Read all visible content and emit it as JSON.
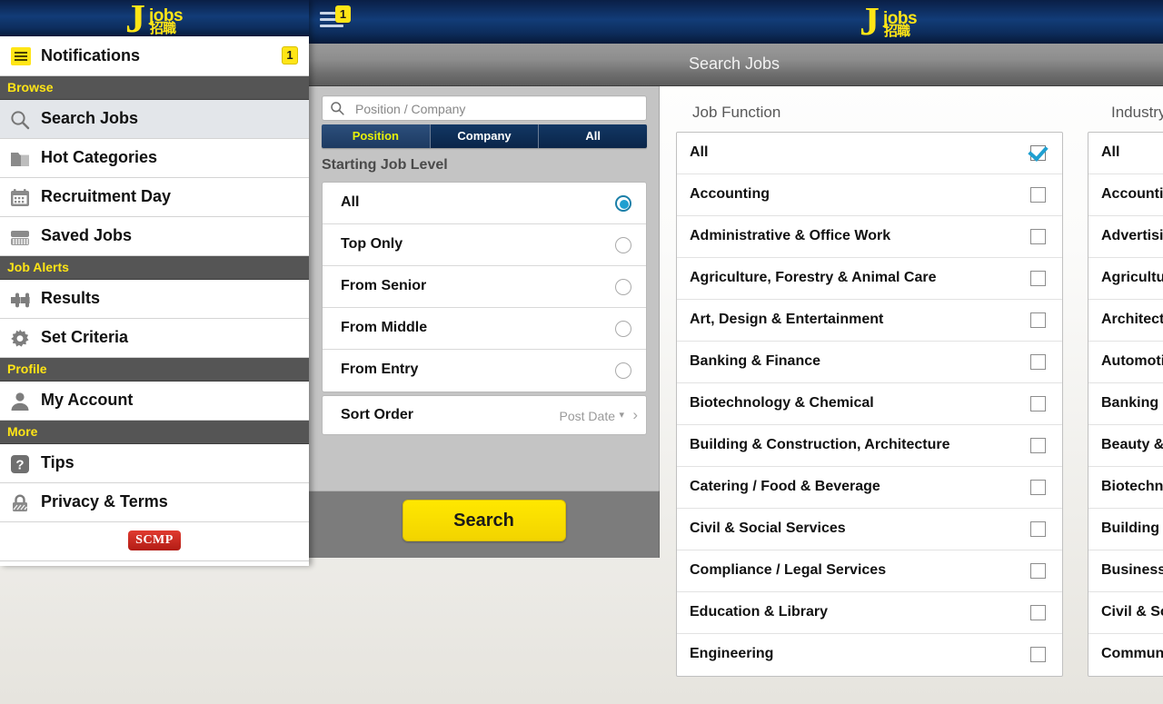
{
  "topbar": {
    "menu_badge": "1",
    "logo": {
      "letter": "J",
      "word": "jobs",
      "cn": "招職"
    }
  },
  "titlebar": {
    "title": "Search Jobs"
  },
  "drawer": {
    "logo": {
      "letter": "J",
      "word": "jobs",
      "cn": "招職"
    },
    "notifications": {
      "label": "Notifications",
      "badge": "1",
      "icon": "menu-list-icon"
    },
    "groups": [
      {
        "header": "Browse",
        "items": [
          {
            "label": "Search Jobs",
            "icon": "search-icon",
            "selected": true
          },
          {
            "label": "Hot Categories",
            "icon": "folder-icon",
            "selected": false
          },
          {
            "label": "Recruitment Day",
            "icon": "calendar-icon",
            "selected": false
          },
          {
            "label": "Saved Jobs",
            "icon": "briefcase-icon",
            "selected": false
          }
        ]
      },
      {
        "header": "Job Alerts",
        "items": [
          {
            "label": "Results",
            "icon": "puzzle-icon",
            "selected": false
          },
          {
            "label": "Set Criteria",
            "icon": "gear-icon",
            "selected": false
          }
        ]
      },
      {
        "header": "Profile",
        "items": [
          {
            "label": "My Account",
            "icon": "person-icon",
            "selected": false
          }
        ]
      },
      {
        "header": "More",
        "items": [
          {
            "label": "Tips",
            "icon": "question-icon",
            "selected": false
          },
          {
            "label": "Privacy & Terms",
            "icon": "lock-icon",
            "selected": false
          }
        ]
      }
    ],
    "footer_logo": "SCMP"
  },
  "search_panel": {
    "query_value": "",
    "query_placeholder": "Position / Company",
    "search_icon": "search-icon",
    "tabs": [
      {
        "label": "Position",
        "active": true
      },
      {
        "label": "Company",
        "active": false
      },
      {
        "label": "All",
        "active": false
      }
    ],
    "job_level": {
      "label": "Starting Job Level",
      "options": [
        {
          "label": "All",
          "selected": true
        },
        {
          "label": "Top Only",
          "selected": false
        },
        {
          "label": "From Senior",
          "selected": false
        },
        {
          "label": "From Middle",
          "selected": false
        },
        {
          "label": "From Entry",
          "selected": false
        }
      ]
    },
    "sort_order": {
      "label": "Sort Order",
      "value": "Post Date",
      "caret": "▾",
      "chevron": "›"
    },
    "search_button": "Search"
  },
  "job_function": {
    "title": "Job Function",
    "items": [
      {
        "label": "All",
        "checked": true
      },
      {
        "label": "Accounting",
        "checked": false
      },
      {
        "label": "Administrative & Office Work",
        "checked": false
      },
      {
        "label": "Agriculture, Forestry & Animal Care",
        "checked": false
      },
      {
        "label": "Art, Design & Entertainment",
        "checked": false
      },
      {
        "label": "Banking & Finance",
        "checked": false
      },
      {
        "label": "Biotechnology & Chemical",
        "checked": false
      },
      {
        "label": "Building & Construction, Architecture",
        "checked": false
      },
      {
        "label": "Catering / Food & Beverage",
        "checked": false
      },
      {
        "label": "Civil & Social Services",
        "checked": false
      },
      {
        "label": "Compliance / Legal Services",
        "checked": false
      },
      {
        "label": "Education & Library",
        "checked": false
      },
      {
        "label": "Engineering",
        "checked": false
      }
    ]
  },
  "industry": {
    "title": "Industry",
    "items": [
      {
        "label": "All",
        "checked": false
      },
      {
        "label": "Accounting",
        "checked": false
      },
      {
        "label": "Advertising",
        "checked": false
      },
      {
        "label": "Agriculture",
        "checked": false
      },
      {
        "label": "Architecture",
        "checked": false
      },
      {
        "label": "Automotive",
        "checked": false
      },
      {
        "label": "Banking & Finance",
        "checked": false
      },
      {
        "label": "Beauty & Fitness",
        "checked": false
      },
      {
        "label": "Biotechnology",
        "checked": false
      },
      {
        "label": "Building & Construction",
        "checked": false
      },
      {
        "label": "Business Services",
        "checked": false
      },
      {
        "label": "Civil & Social Services",
        "checked": false
      },
      {
        "label": "Communications",
        "checked": false
      }
    ]
  },
  "colors": {
    "brand_blue": "#123c78",
    "brand_yellow": "#ffe516",
    "accent_teal": "#1f9fd0",
    "group_header_bg": "#555555",
    "panel_gray": "#c4c4c4"
  }
}
